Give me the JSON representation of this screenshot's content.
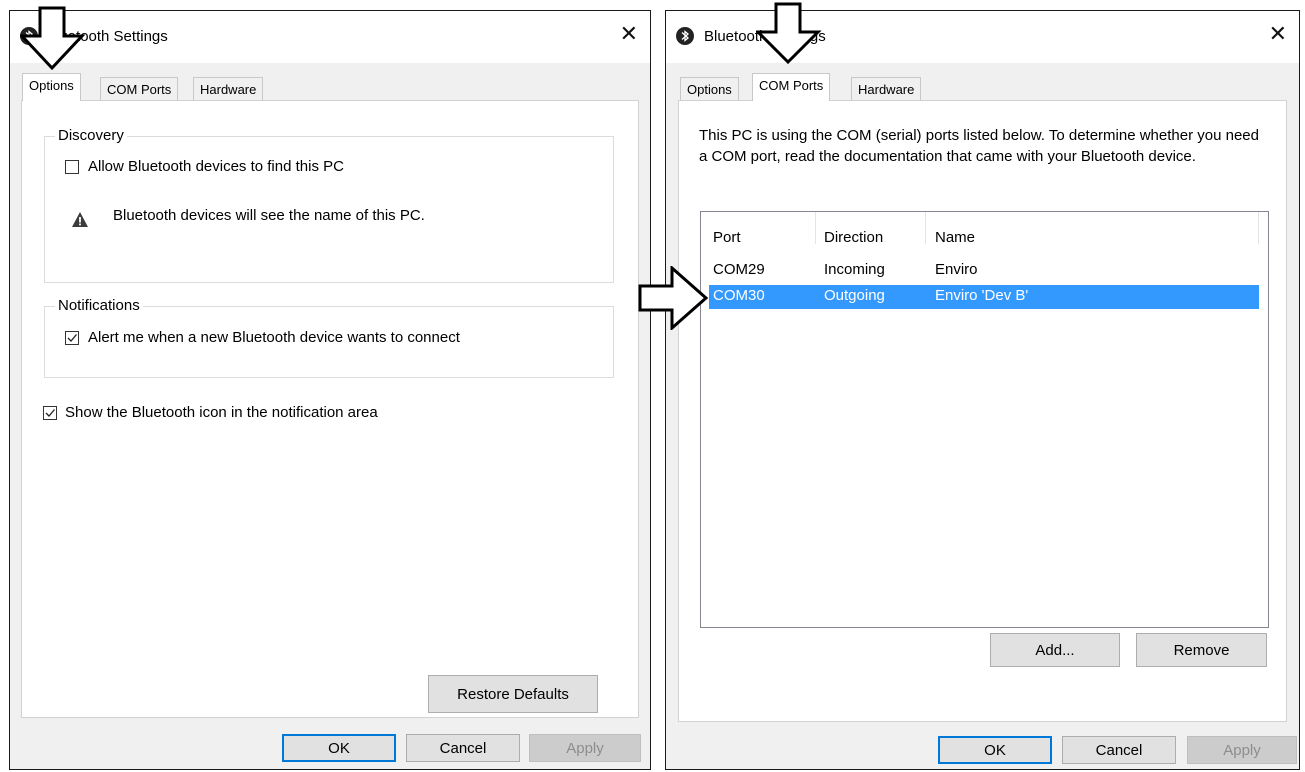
{
  "left_dialog": {
    "title": "Bluetooth Settings",
    "tabs": [
      "Options",
      "COM Ports",
      "Hardware"
    ],
    "active_tab": "Options",
    "discovery": {
      "legend": "Discovery",
      "allow_label": "Allow Bluetooth devices to find this PC",
      "allow_checked": false,
      "warning_text": "Bluetooth devices will see the name of this PC."
    },
    "notifications": {
      "legend": "Notifications",
      "alert_label": "Alert me when a new Bluetooth device wants to connect",
      "alert_checked": true
    },
    "show_icon_label": "Show the Bluetooth icon in the notification area",
    "show_icon_checked": true,
    "restore_defaults": "Restore Defaults",
    "ok": "OK",
    "cancel": "Cancel",
    "apply": "Apply"
  },
  "right_dialog": {
    "title": "Bluetooth Settings",
    "tabs": [
      "Options",
      "COM Ports",
      "Hardware"
    ],
    "active_tab": "COM Ports",
    "description": "This PC is using the COM (serial) ports listed below. To determine whether you need a COM port, read the documentation that came with your Bluetooth device.",
    "columns": [
      "Port",
      "Direction",
      "Name"
    ],
    "rows": [
      {
        "port": "COM29",
        "direction": "Incoming",
        "name": "Enviro"
      },
      {
        "port": "COM30",
        "direction": "Outgoing",
        "name": "Enviro 'Dev B'"
      }
    ],
    "selected_row": 1,
    "add": "Add...",
    "remove": "Remove",
    "ok": "OK",
    "cancel": "Cancel",
    "apply": "Apply"
  },
  "colors": {
    "selection": "#3399ff",
    "default_button_border": "#0078d7"
  },
  "icons": [
    "bluetooth-icon",
    "close-icon",
    "warning-icon",
    "checkmark-icon",
    "arrow-down-icon",
    "arrow-right-icon"
  ]
}
